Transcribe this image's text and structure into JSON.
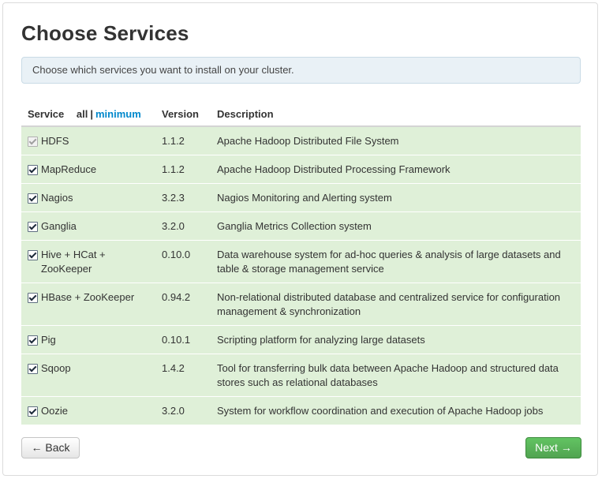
{
  "page": {
    "title": "Choose Services",
    "info": "Choose which services you want to install on your cluster."
  },
  "table": {
    "headers": {
      "service": "Service",
      "all": "all",
      "separator": "|",
      "minimum": "minimum",
      "version": "Version",
      "description": "Description"
    },
    "rows": [
      {
        "name": "HDFS",
        "version": "1.1.2",
        "description": "Apache Hadoop Distributed File System",
        "checked": true,
        "disabled": true
      },
      {
        "name": "MapReduce",
        "version": "1.1.2",
        "description": "Apache Hadoop Distributed Processing Framework",
        "checked": true,
        "disabled": false
      },
      {
        "name": "Nagios",
        "version": "3.2.3",
        "description": "Nagios Monitoring and Alerting system",
        "checked": true,
        "disabled": false
      },
      {
        "name": "Ganglia",
        "version": "3.2.0",
        "description": "Ganglia Metrics Collection system",
        "checked": true,
        "disabled": false
      },
      {
        "name": "Hive + HCat + ZooKeeper",
        "version": "0.10.0",
        "description": "Data warehouse system for ad-hoc queries & analysis of large datasets and table & storage management service",
        "checked": true,
        "disabled": false
      },
      {
        "name": "HBase + ZooKeeper",
        "version": "0.94.2",
        "description": "Non-relational distributed database and centralized service for configuration management & synchronization",
        "checked": true,
        "disabled": false
      },
      {
        "name": "Pig",
        "version": "0.10.1",
        "description": "Scripting platform for analyzing large datasets",
        "checked": true,
        "disabled": false
      },
      {
        "name": "Sqoop",
        "version": "1.4.2",
        "description": "Tool for transferring bulk data between Apache Hadoop and structured data stores such as relational databases",
        "checked": true,
        "disabled": false
      },
      {
        "name": "Oozie",
        "version": "3.2.0",
        "description": "System for workflow coordination and execution of Apache Hadoop jobs",
        "checked": true,
        "disabled": false
      }
    ]
  },
  "buttons": {
    "back": "← Back",
    "next": "Next →"
  },
  "colors": {
    "row_bg": "#dff0d8",
    "link": "#0088cc",
    "next_button": "#5bb75b"
  }
}
